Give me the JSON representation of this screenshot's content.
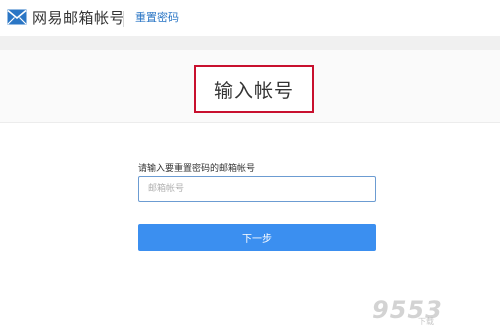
{
  "header": {
    "brand": "网易邮箱帐号",
    "reset_link": "重置密码",
    "logo_icon": "mail-envelope-icon"
  },
  "page": {
    "title": "输入帐号"
  },
  "form": {
    "label": "请输入要重置密码的邮箱帐号",
    "email_placeholder": "邮箱帐号",
    "email_value": "",
    "next_button": "下一步"
  },
  "watermark": {
    "main": "9553",
    "sub": "下载"
  },
  "colors": {
    "brand_blue": "#2a76c5",
    "button_blue": "#3b8ff0",
    "input_border": "#6c9cd2",
    "highlight_red": "#c8102e"
  }
}
